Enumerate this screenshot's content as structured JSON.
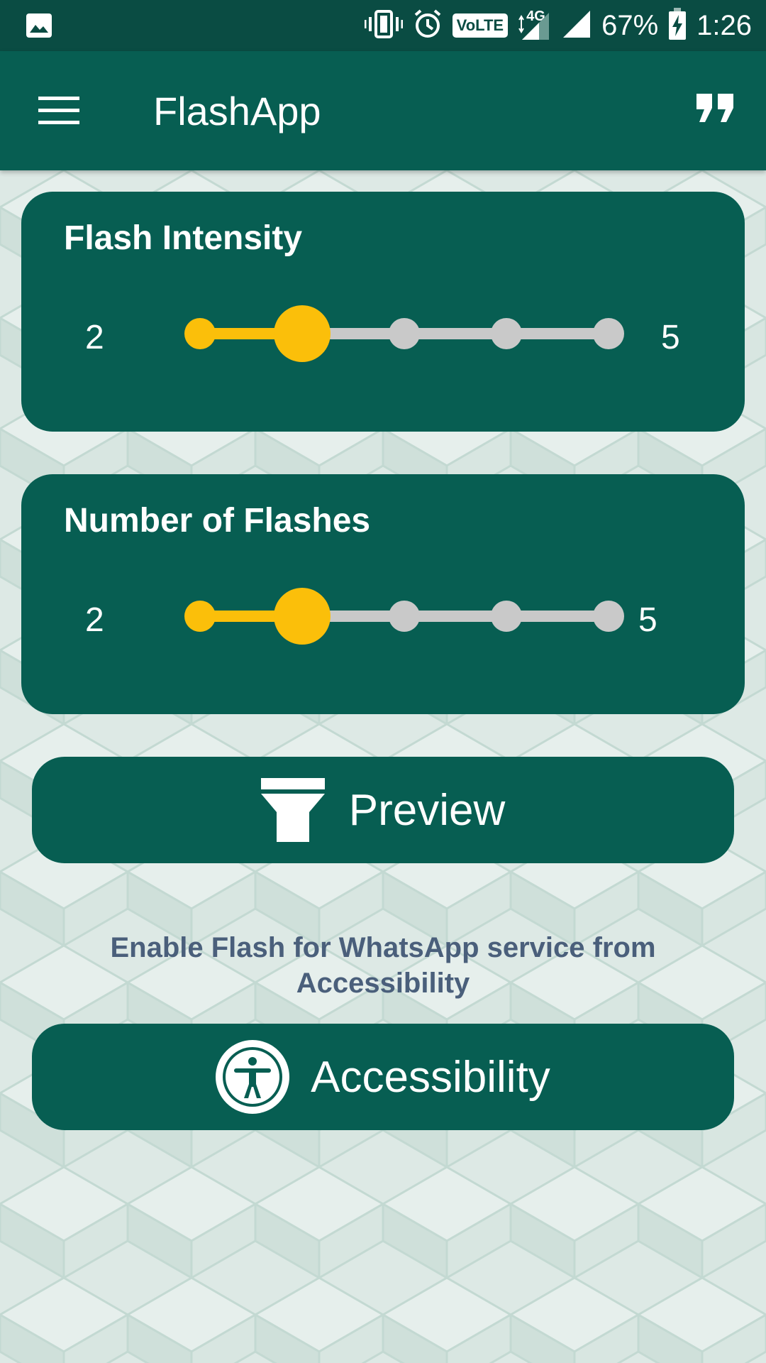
{
  "status_bar": {
    "volte": "VoLTE",
    "network": "4G",
    "battery": "67%",
    "time": "1:26",
    "icons": [
      "image-icon",
      "vibrate-icon",
      "alarm-icon",
      "signal-icon",
      "battery-charging-icon"
    ]
  },
  "app_bar": {
    "title": "FlashApp",
    "icons": [
      "menu-icon",
      "quote-icon"
    ]
  },
  "flash_intensity": {
    "title": "Flash Intensity",
    "min_label": "2",
    "max_label": "5",
    "steps": 5,
    "selected_step": 2
  },
  "number_of_flashes": {
    "title": "Number of Flashes",
    "min_label": "2",
    "max_label": "5",
    "steps": 5,
    "selected_step": 2
  },
  "preview_button": {
    "label": "Preview",
    "icon": "flashlight-icon"
  },
  "info": {
    "text": "Enable Flash for WhatsApp service from Accessibility"
  },
  "accessibility_button": {
    "label": "Accessibility",
    "icon": "accessibility-icon"
  },
  "colors": {
    "primary": "#075e52",
    "status_bar": "#0a4c43",
    "accent": "#fbbf0a",
    "track_inactive": "#c9c9c9",
    "info_text": "#4a5f7b",
    "background": "#dde9e5"
  }
}
